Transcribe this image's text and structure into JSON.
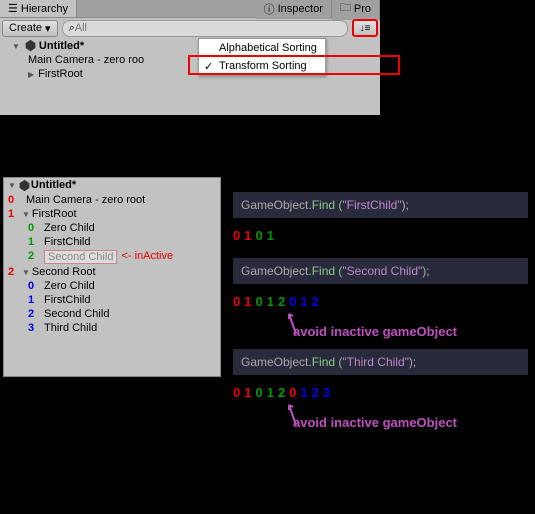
{
  "top": {
    "tabs": {
      "hierarchy": "Hierarchy",
      "inspector": "Inspector",
      "project": "Pro"
    },
    "toolbar": {
      "create": "Create",
      "search": "All"
    },
    "sortMenu": {
      "alpha": "Alphabetical Sorting",
      "transform": "Transform Sorting"
    },
    "tree": {
      "title": "Untitled*",
      "row0": "Main Camera - zero roo",
      "row1": "FirstRoot"
    }
  },
  "bottom": {
    "title": "Untitled*",
    "rows": {
      "root0": {
        "n": "0",
        "label": "Main Camera - zero root"
      },
      "root1": {
        "n": "1",
        "label": "FirstRoot"
      },
      "r1c0": {
        "n": "0",
        "label": "Zero Child"
      },
      "r1c1": {
        "n": "1",
        "label": "FirstChild"
      },
      "r1c2": {
        "n": "2",
        "label": "Second Child",
        "note": "<- inActive"
      },
      "root2": {
        "n": "2",
        "label": "Second Root"
      },
      "r2c0": {
        "n": "0",
        "label": "Zero Child"
      },
      "r2c1": {
        "n": "1",
        "label": "FirstChild"
      },
      "r2c2": {
        "n": "2",
        "label": "Second Child"
      },
      "r2c3": {
        "n": "3",
        "label": "Third Child"
      }
    }
  },
  "code": {
    "line1": {
      "pre": "GameObject",
      "method": ".Find (",
      "arg": "\"FirstChild\"",
      "post": ");"
    },
    "trav1": [
      {
        "c": "red",
        "v": "0"
      },
      {
        "c": "red",
        "v": "1"
      },
      {
        "c": "green",
        "v": "0"
      },
      {
        "c": "green",
        "v": "1"
      }
    ],
    "line2": {
      "pre": "GameObject",
      "method": ".Find (",
      "arg": "\"Second Child\"",
      "post": ");"
    },
    "trav2": [
      {
        "c": "red",
        "v": "0"
      },
      {
        "c": "red",
        "v": "1"
      },
      {
        "c": "green",
        "v": "0"
      },
      {
        "c": "green",
        "v": "1"
      },
      {
        "c": "green",
        "v": "2"
      },
      {
        "c": "blue",
        "v": "0"
      },
      {
        "c": "blue",
        "v": "1"
      },
      {
        "c": "blue",
        "v": "2"
      }
    ],
    "ann2": "avoid inactive gameObject",
    "line3": {
      "pre": "GameObject",
      "method": ".Find (",
      "arg": "\"Third Child\"",
      "post": ");"
    },
    "trav3": [
      {
        "c": "red",
        "v": "0"
      },
      {
        "c": "red",
        "v": "1"
      },
      {
        "c": "green",
        "v": "0"
      },
      {
        "c": "green",
        "v": "1"
      },
      {
        "c": "green",
        "v": "2"
      },
      {
        "c": "red",
        "v": "0"
      },
      {
        "c": "blue",
        "v": "1"
      },
      {
        "c": "blue",
        "v": "2"
      },
      {
        "c": "blue",
        "v": "3"
      }
    ],
    "ann3": "avoid inactive gameObject"
  }
}
